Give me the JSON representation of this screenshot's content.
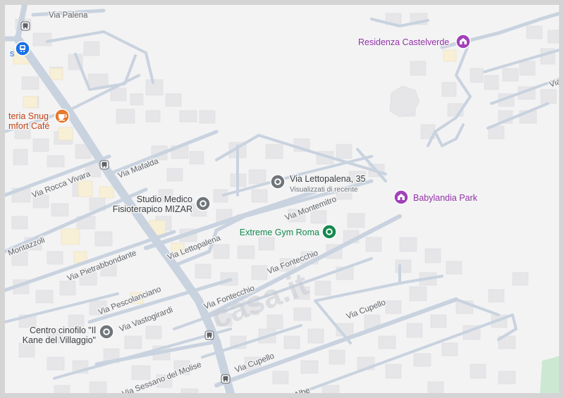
{
  "map": {
    "colors": {
      "background": "#f3f3f4",
      "road": "#c9d3df",
      "building": "#e6e6e9",
      "park": "#cde8d2",
      "poi_purple": "#a142b8",
      "poi_gray": "#70757a",
      "poi_green": "#14894e",
      "poi_orange": "#e8762b",
      "transit_blue": "#1a73e8"
    },
    "streets": {
      "palena": "Via Palena",
      "rocca_vivara": "Via Rocca Vivara",
      "mafalda": "Via Mafalda",
      "montazzoli": "Montazzoli",
      "pietrabbondante": "Via Pietrabbondante",
      "lettopalena": "Via Lettopalena",
      "montemitro": "Via Montemitro",
      "fontecchio_1": "Via Fontecchio",
      "fontecchio_2": "Via Fontecchio",
      "pescolanciano": "Via Pescolanciano",
      "vastogirardi": "Via Vastogirardi",
      "cupello_1": "Via Cupello",
      "cupello_2": "Via Cupello",
      "sessano": "Via Sessano del Molise",
      "albe": "d'Albe",
      "via_right": "Via"
    },
    "pois": {
      "residenza": "Residenza Castelverde",
      "lettopalena_35": "Via Lettopalena, 35",
      "lettopalena_sub": "Visualizzati di recente",
      "babylandia": "Babylandia Park",
      "studio_line1": "Studio Medico",
      "studio_line2": "Fisioterapico MIZAR",
      "extreme_gym": "Extreme Gym Roma",
      "centro_line1": "Centro cinofilo \"Il",
      "centro_line2": "Kane del Villaggio\"",
      "snug_line1": "teria Snug",
      "snug_line2": "mfort Café",
      "left_edge_fragment": "s"
    },
    "watermark": "casa.it",
    "icons": [
      "bus-stop-icon",
      "bus-stop-icon",
      "bus-stop-icon",
      "bus-stop-icon",
      "cafe-icon",
      "amusement-park-icon",
      "place-pin-icon",
      "gym-icon",
      "transit-station-icon"
    ]
  }
}
